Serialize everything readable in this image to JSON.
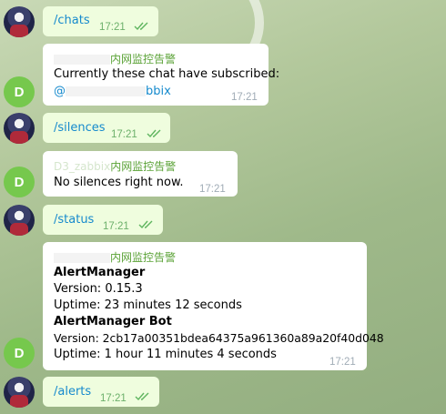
{
  "messages": {
    "m1": {
      "text": "/chats",
      "time": "17:21"
    },
    "m2": {
      "sender": "内网监控告警",
      "line1": "Currently these chat have subscribed:",
      "mention": "@",
      "mention_tail": "bbix",
      "time": "17:21"
    },
    "m3": {
      "text": "/silences",
      "time": "17:21"
    },
    "m4": {
      "sender": "内网监控告警",
      "sender_prefix": "D3_zabbix",
      "line1": "No silences right now.",
      "time": "17:21"
    },
    "m5": {
      "text": "/status",
      "time": "17:21"
    },
    "m6": {
      "sender": "内网监控告警",
      "title1": "AlertManager",
      "version1": "Version: 0.15.3",
      "uptime1": "Uptime: 23 minutes 12 seconds",
      "title2": "AlertManager Bot",
      "version2": "Version: 2cb17a00351bdea64375a961360a89a20f40d048",
      "uptime2": "Uptime: 1 hour 11 minutes 4 seconds",
      "time": "17:21"
    },
    "m7": {
      "text": "/alerts",
      "time": "17:21"
    }
  },
  "bot_initial": "D",
  "colors": {
    "outgoing": "#effdde",
    "incoming": "#ffffff",
    "accent": "#168acd",
    "sender": "#5aa236",
    "bot_avatar": "#76c84d"
  }
}
